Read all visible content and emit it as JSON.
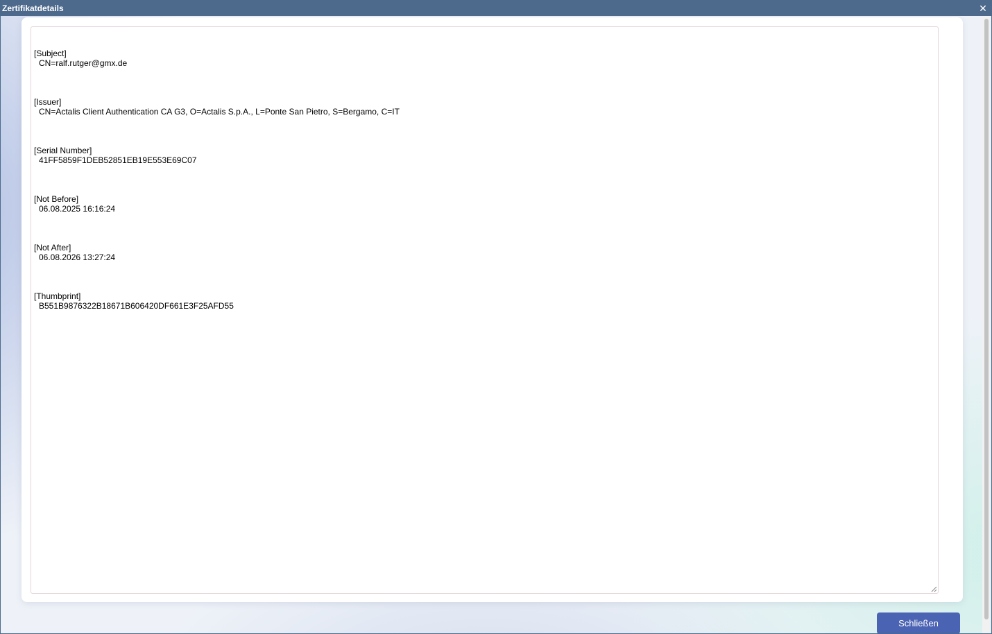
{
  "window": {
    "title": "Zertifikatdetails",
    "close_glyph": "✕"
  },
  "certificate": {
    "sections": [
      {
        "label": "[Subject]",
        "value": "CN=ralf.rutger@gmx.de"
      },
      {
        "label": "[Issuer]",
        "value": "CN=Actalis Client Authentication CA G3, O=Actalis S.p.A., L=Ponte San Pietro, S=Bergamo, C=IT"
      },
      {
        "label": "[Serial Number]",
        "value": "41FF5859F1DEB52851EB19E553E69C07"
      },
      {
        "label": "[Not Before]",
        "value": "06.08.2025 16:16:24"
      },
      {
        "label": "[Not After]",
        "value": "06.08.2026 13:27:24"
      },
      {
        "label": "[Thumbprint]",
        "value": "B551B9876322B18671B606420DF661E3F25AFD55"
      }
    ]
  },
  "footer": {
    "close_label": "Schließen"
  },
  "colors": {
    "titlebar": "#4d6a8c",
    "button": "#4b63b3"
  }
}
